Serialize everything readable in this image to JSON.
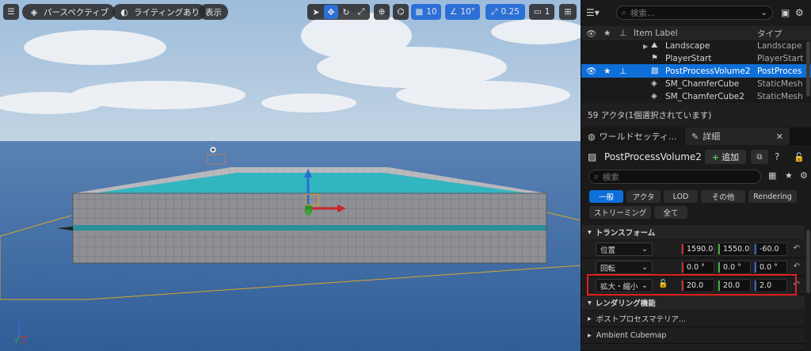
{
  "viewport": {
    "menu_icon": "hamburger-icon",
    "perspective_label": "パースペクティブ",
    "lighting_label": "ライティングあり",
    "show_label": "表示",
    "grid_snap_value": "10",
    "rotation_snap_value": "10°",
    "scale_snap_value": "0.25",
    "camera_speed_value": "1",
    "axis": {
      "z": "Z",
      "y": "Y",
      "x": "X"
    }
  },
  "outliner": {
    "search_placeholder": "検索...",
    "columns": {
      "label": "Item Label",
      "type": "タイプ"
    },
    "rows": [
      {
        "name": "Landscape",
        "type": "Landscape",
        "icon": "landscape-icon",
        "selected": false
      },
      {
        "name": "PlayerStart",
        "type": "PlayerStart",
        "icon": "player-start-icon",
        "selected": false
      },
      {
        "name": "PostProcessVolume2",
        "type": "PostProces",
        "icon": "volume-icon",
        "selected": true
      },
      {
        "name": "SM_ChamferCube",
        "type": "StaticMesh",
        "icon": "static-mesh-icon",
        "selected": false
      },
      {
        "name": "SM_ChamferCube2",
        "type": "StaticMesh",
        "icon": "static-mesh-icon",
        "selected": false
      }
    ],
    "status": "59 アクタ(1個選択されています)"
  },
  "details": {
    "tab_world": "ワールドセッティ...",
    "tab_details": "詳細",
    "actor_name": "PostProcessVolume2",
    "add_label": "追加",
    "search_placeholder": "検索",
    "filters": [
      "一般",
      "アクタ",
      "LOD",
      "その他",
      "Rendering",
      "ストリーミング",
      "全て"
    ],
    "transform_section": "トランスフォーム",
    "location": {
      "label": "位置",
      "x": "1590.0",
      "y": "1550.0",
      "z": "-60.0"
    },
    "rotation": {
      "label": "回転",
      "x": "0.0 °",
      "y": "0.0 °",
      "z": "0.0 °"
    },
    "scale": {
      "label": "拡大・縮小",
      "x": "20.0",
      "y": "20.0",
      "z": "2.0"
    },
    "rendering_section": "レンダリング機能",
    "collapsed_items": [
      "ポストプロセスマテリア...",
      "Ambient Cubemap"
    ],
    "highlight_color": "#e02020"
  }
}
